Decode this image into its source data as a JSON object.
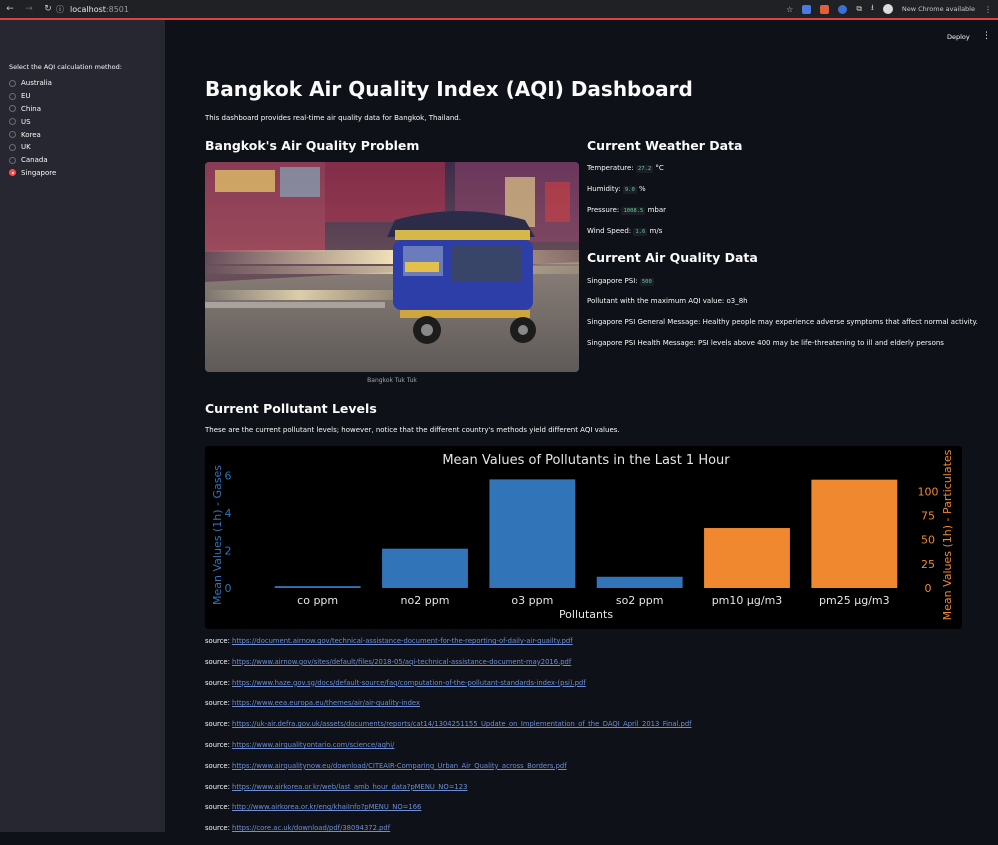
{
  "browser": {
    "url_host": "localhost",
    "url_port": ":8501",
    "update_label": "New Chrome available"
  },
  "sidebar": {
    "radio_label": "Select the AQI calculation method:",
    "options": [
      "Australia",
      "EU",
      "China",
      "US",
      "Korea",
      "UK",
      "Canada",
      "Singapore"
    ],
    "selected": "Singapore"
  },
  "header": {
    "deploy_label": "Deploy"
  },
  "main": {
    "title": "Bangkok Air Quality Index (AQI) Dashboard",
    "intro": "This dashboard provides real-time air quality data for Bangkok, Thailand.",
    "problem_heading": "Bangkok's Air Quality Problem",
    "image_caption": "Bangkok Tuk Tuk",
    "weather_heading": "Current Weather Data",
    "weather": {
      "temperature_label": "Temperature:",
      "temperature_value": "27.2",
      "temperature_unit": "°C",
      "humidity_label": "Humidity:",
      "humidity_value": "9.0",
      "humidity_unit": "%",
      "pressure_label": "Pressure:",
      "pressure_value": "1008.5",
      "pressure_unit": "mbar",
      "wind_label": "Wind Speed:",
      "wind_value": "1.6",
      "wind_unit": "m/s"
    },
    "aq_heading": "Current Air Quality Data",
    "aq": {
      "psi_label": "Singapore PSI:",
      "psi_value": "500",
      "max_pollutant": "Pollutant with the maximum AQI value: o3_8h",
      "general_message": "Singapore PSI General Message: Healthy people may experience adverse symptoms that affect normal activity.",
      "health_message": "Singapore PSI Health Message: PSI levels above 400 may be life-threatening to ill and elderly persons"
    },
    "pollutant_heading": "Current Pollutant Levels",
    "pollutant_desc": "These are the current pollutant levels; however, notice that the different country's methods yield different AQI values."
  },
  "chart_data": {
    "type": "bar",
    "title": "Mean Values of Pollutants in the Last 1 Hour",
    "xlabel": "Pollutants",
    "ylabel_left": "Mean Values (1h) - Gases",
    "ylabel_right": "Mean Values (1h) - Particulates",
    "categories": [
      "co ppm",
      "no2 ppm",
      "o3 ppm",
      "so2 ppm",
      "pm10 µg/m3",
      "pm25 µg/m3"
    ],
    "series": [
      {
        "name": "Gases",
        "axis": "left",
        "color": "#3274b8",
        "values": [
          0.1,
          2.1,
          5.8,
          0.6,
          null,
          null
        ]
      },
      {
        "name": "Particulates",
        "axis": "right",
        "color": "#f0882f",
        "values": [
          null,
          null,
          null,
          null,
          62,
          112
        ]
      }
    ],
    "ylim_left": [
      0,
      6.3
    ],
    "ylim_right": [
      0,
      122
    ],
    "yticks_left": [
      0,
      2,
      4,
      6
    ],
    "yticks_right": [
      0,
      25,
      50,
      75,
      100
    ],
    "grid": false
  },
  "sources": {
    "prefix": "source:",
    "links": [
      "https://document.airnow.gov/technical-assistance-document-for-the-reporting-of-daily-air-quailty.pdf",
      "https://www.airnow.gov/sites/default/files/2018-05/aqi-technical-assistance-document-may2016.pdf",
      "https://www.haze.gov.sg/docs/default-source/faq/computation-of-the-pollutant-standards-index-(psi).pdf",
      "https://www.eea.europa.eu/themes/air/air-quality-index",
      "https://uk-air.defra.gov.uk/assets/documents/reports/cat14/1304251155_Update_on_Implementation_of_the_DAQI_April_2013_Final.pdf",
      "https://www.airqualityontario.com/science/aqhi/",
      "https://www.airqualitynow.eu/download/CITEAIR-Comparing_Urban_Air_Quality_across_Borders.pdf",
      "https://www.airkorea.or.kr/web/last_amb_hour_data?pMENU_NO=123",
      "http://www.airkorea.or.kr/eng/khaiInfo?pMENU_NO=166",
      "https://core.ac.uk/download/pdf/38094372.pdf"
    ]
  }
}
